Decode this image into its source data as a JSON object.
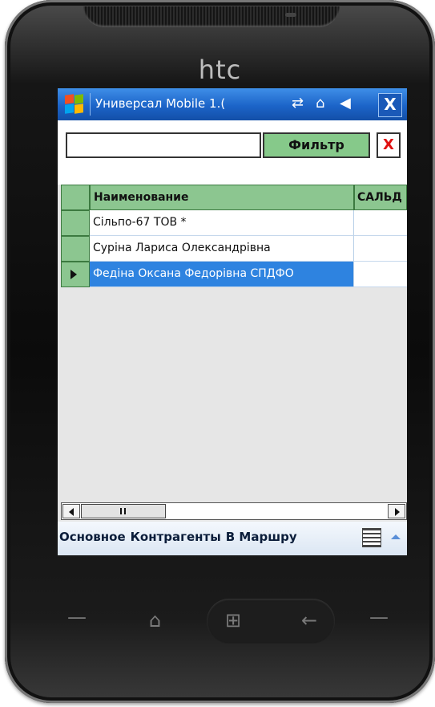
{
  "device": {
    "brand": "htc",
    "hardware_icons": [
      "phone-answer-icon",
      "home-icon",
      "windows-start-icon",
      "back-icon",
      "phone-hangup-icon"
    ]
  },
  "window": {
    "title": "Универсал Mobile 1.(",
    "close_label": "X",
    "status_icons": [
      "connectivity-icon",
      "signal-icon",
      "volume-icon"
    ]
  },
  "filter": {
    "input_value": "",
    "button_label": "Фильтр",
    "clear_label": "X"
  },
  "grid": {
    "columns": [
      "Наименование",
      "САЛЬД"
    ],
    "rows": [
      {
        "name": "Сільпо-67 ТОВ *",
        "balance": ""
      },
      {
        "name": "Суріна Лариса Олександрівна",
        "balance": ""
      },
      {
        "name": "Федіна Оксана Федорівна СПДФО",
        "balance": "",
        "selected": true
      }
    ]
  },
  "menubar": {
    "items": [
      "Основное",
      "Контрагенты",
      "В Маршру"
    ]
  },
  "colors": {
    "title_blue": "#1c64c8",
    "header_green": "#8cc690",
    "selection_blue": "#2e83e0",
    "clear_red": "#e01010"
  }
}
